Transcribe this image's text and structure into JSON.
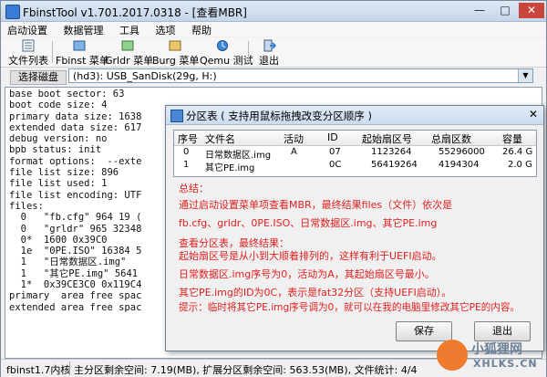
{
  "window": {
    "title": "FbinstTool v1.701.2017.0318 - [查看MBR]"
  },
  "menu": [
    "启动设置",
    "数据管理",
    "工具",
    "选项",
    "帮助"
  ],
  "toolbar": {
    "file_list": "文件列表",
    "fbinst_menu": "Fbinst 菜单",
    "grldr_menu": "Grldr 菜单",
    "burg_menu": "Burg 菜单",
    "qemu_test": "Qemu 测试",
    "exit": "退出"
  },
  "disk": {
    "label": "选择磁盘",
    "value": "(hd3): USB_SanDisk(29g, H:)"
  },
  "text_lines": [
    "base boot sector: 63",
    "boot code size: 4",
    "primary data size: 1638",
    "extended data size: 617",
    "debug version: no",
    "bpb status: init",
    "format options:  --exte",
    "file list size: 896",
    "file list used: 1",
    "file list encoding: UTF",
    "files:",
    "  0   \"fb.cfg\" 964 19 (",
    "  0   \"grldr\" 965 32348",
    "  0*  1600 0x39C0",
    "  1e  \"0PE.ISO\" 16384 5",
    "  1   \"日常数据区.img\"",
    "  1   \"其它PE.img\" 5641",
    "  1*  0x39CE3C0 0x119C4",
    "primary  area free spac",
    "extended area free spac"
  ],
  "status": {
    "version": "fbinst1.7内核",
    "primary_free": "主分区剩余空间: 7.19(MB), 扩展分区剩余空间: 563.53(MB), 文件统计: 4/4"
  },
  "dialog": {
    "title": "分区表 ( 支持用鼠标拖拽改变分区顺序 )",
    "columns": [
      "序号",
      "文件名",
      "活动",
      "ID",
      "起始扇区号",
      "总扇区数",
      "容量"
    ],
    "rows": [
      {
        "no": "0",
        "name": "日常数据区.img",
        "active": "A",
        "id": "07",
        "start": "1123264",
        "total": "55296000",
        "size": "26.4 G"
      },
      {
        "no": "1",
        "name": "其它PE.img",
        "active": "",
        "id": "0C",
        "start": "56419264",
        "total": "4194304",
        "size": "2.0 G"
      }
    ],
    "info": [
      "总结：",
      "通过启动设置菜单项查看MBR，最终结果files（文件）依次是",
      "fb.cfg、grldr、0PE.ISO、日常数据区.img、其它PE.img",
      "查看分区表，最终结果：",
      "起始扇区号是从小到大顺着排列的，这样有利于UEFI启动。",
      "日常数据区.img序号为0，活动为A，其起始扇区号最小。",
      "其它PE.img的ID为0C，表示是fat32分区（支持UEFI启动）。",
      "提示：临时将其它PE.img序号调为0，就可以在我的电脑里修改其它PE的内容。"
    ],
    "save": "保存",
    "exit": "退出"
  },
  "watermark": {
    "cn": "小狐狸网",
    "en": "XHLKS.CN"
  },
  "colors": {
    "info_text": "#e02020",
    "accent": "#3a7bd5"
  }
}
